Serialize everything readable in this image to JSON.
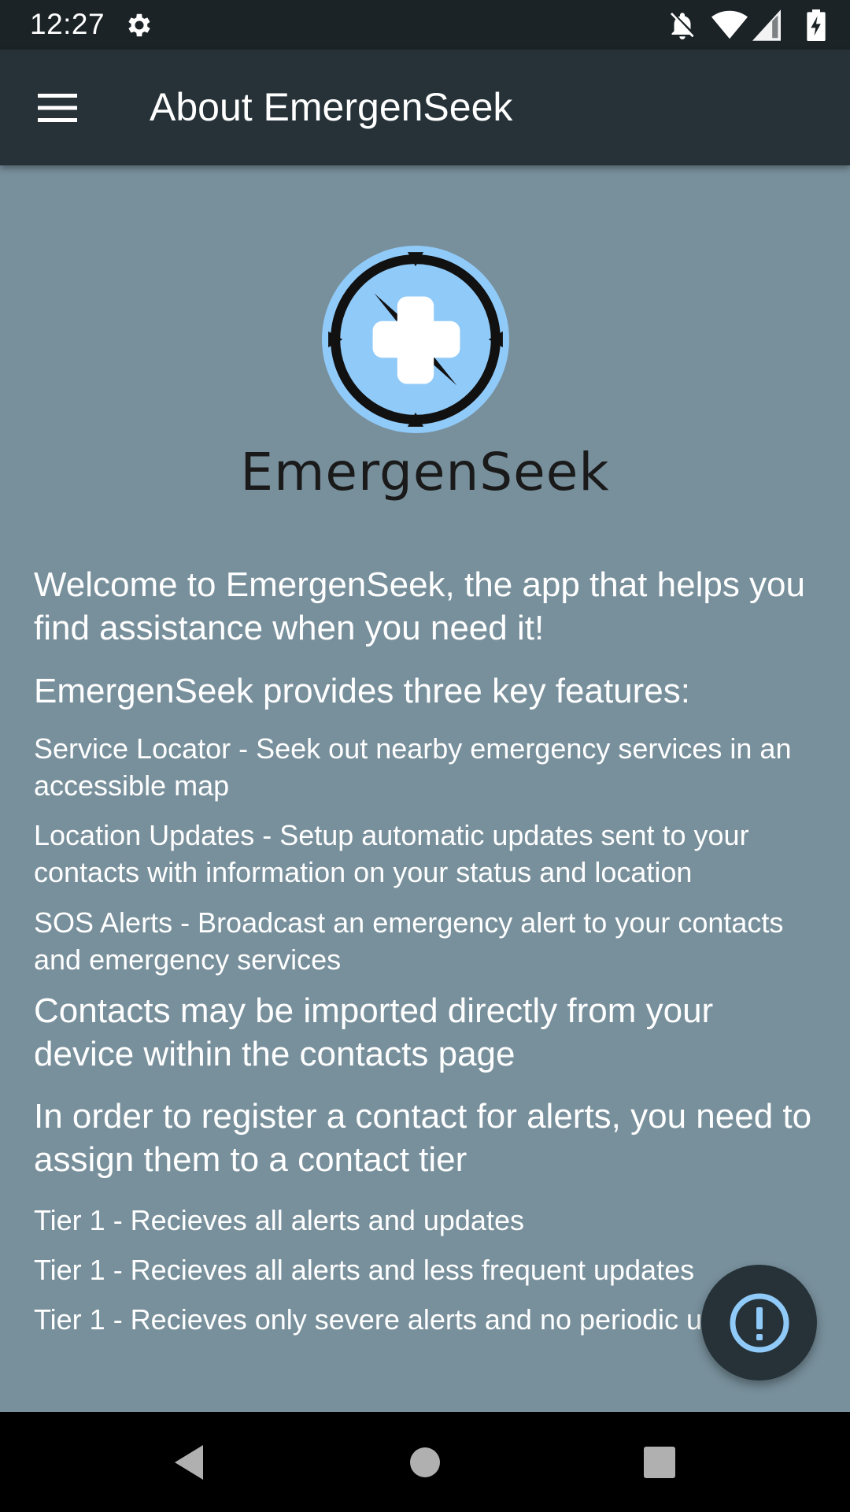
{
  "status_bar": {
    "time": "12:27",
    "icons": [
      "gear-icon",
      "notifications-off-icon",
      "wifi-icon",
      "cell-signal-icon",
      "battery-charging-icon"
    ]
  },
  "app_bar": {
    "menu_icon": "hamburger-menu-icon",
    "title": "About EmergenSeek"
  },
  "logo": {
    "wordmark": "EmergenSeek",
    "colors": {
      "ring": "#90caf9",
      "frame": "#111111",
      "cross": "#ffffff"
    }
  },
  "content": {
    "welcome": "Welcome to EmergenSeek, the app that helps you find assistance when you need it!",
    "features_heading": "EmergenSeek provides three key features:",
    "features": [
      "Service Locator - Seek out nearby emergency services in an accessible map",
      "Location Updates - Setup automatic updates sent to your contacts with information on your status and location",
      "SOS Alerts - Broadcast an emergency alert to your contacts and emergency services"
    ],
    "contacts_info": "Contacts may be imported directly from your device within the contacts page",
    "tier_info": "In order to register a contact for alerts, you need to assign them to a contact tier",
    "tiers": [
      "Tier 1 - Recieves all alerts and updates",
      "Tier 1 - Recieves all alerts and less frequent updates",
      "Tier 1 - Recieves only severe alerts and no periodic updates"
    ]
  },
  "fab": {
    "icon": "alert-exclamation-icon",
    "color": "#90caf9"
  },
  "nav_bar": {
    "icons": [
      "back-icon",
      "home-icon",
      "recents-icon"
    ]
  },
  "colors": {
    "status_bar": "#1c2327",
    "app_bar": "#263238",
    "background": "#78909c",
    "text": "#ffffff"
  }
}
